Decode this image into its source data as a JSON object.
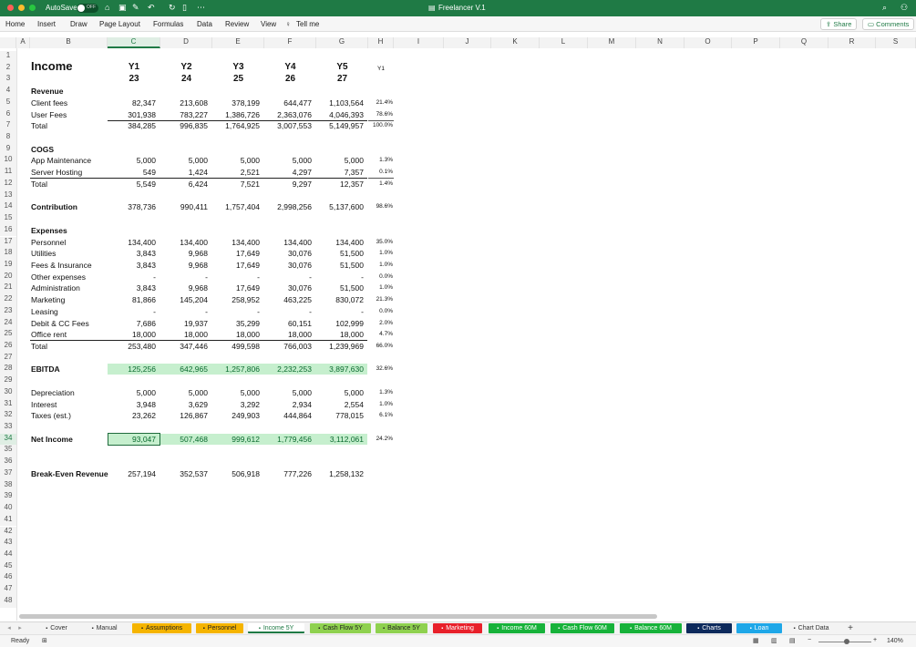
{
  "app": {
    "autosave_label": "AutoSave",
    "autosave_state": "OFF",
    "title": "Freelancer V.1",
    "menu": [
      "Home",
      "Insert",
      "Draw",
      "Page Layout",
      "Formulas",
      "Data",
      "Review",
      "View",
      "Tell me"
    ],
    "share_label": "Share",
    "comments_label": "Comments"
  },
  "columns": [
    "A",
    "B",
    "C",
    "D",
    "E",
    "F",
    "G",
    "H",
    "I",
    "J",
    "K",
    "L",
    "M",
    "N",
    "O",
    "P",
    "Q",
    "R",
    "S"
  ],
  "row_numbers": [
    "1",
    "2",
    "3",
    "4",
    "5",
    "6",
    "7",
    "8",
    "9",
    "10",
    "11",
    "12",
    "13",
    "14",
    "15",
    "16",
    "17",
    "18",
    "19",
    "20",
    "21",
    "22",
    "23",
    "24",
    "25",
    "26",
    "27",
    "28",
    "29",
    "30",
    "31",
    "32",
    "33",
    "34",
    "35",
    "36",
    "37",
    "38",
    "39",
    "40",
    "41",
    "42",
    "43",
    "44",
    "45",
    "46",
    "47",
    "48"
  ],
  "sheet": {
    "title": "Income",
    "year_labels": [
      "Y1",
      "Y2",
      "Y3",
      "Y4",
      "Y5"
    ],
    "years": [
      "23",
      "24",
      "25",
      "26",
      "27"
    ],
    "pct_header": "Y1",
    "rows": [
      {
        "row": 4,
        "label": "Revenue",
        "bold": true
      },
      {
        "row": 5,
        "label": "Client fees",
        "values": [
          "82,347",
          "213,608",
          "378,199",
          "644,477",
          "1,103,564"
        ],
        "pct": "21.4%"
      },
      {
        "row": 6,
        "label": "User Fees",
        "values": [
          "301,938",
          "783,227",
          "1,386,726",
          "2,363,076",
          "4,046,393"
        ],
        "pct": "78.6%"
      },
      {
        "row": 7,
        "label": "Total",
        "values": [
          "384,285",
          "996,835",
          "1,764,925",
          "3,007,553",
          "5,149,957"
        ],
        "pct": "100.0%"
      },
      {
        "row": 9,
        "label": "COGS",
        "bold": true
      },
      {
        "row": 10,
        "label": "App Maintenance",
        "values": [
          "5,000",
          "5,000",
          "5,000",
          "5,000",
          "5,000"
        ],
        "pct": "1.3%"
      },
      {
        "row": 11,
        "label": "Server Hosting",
        "values": [
          "549",
          "1,424",
          "2,521",
          "4,297",
          "7,357"
        ],
        "pct": "0.1%"
      },
      {
        "row": 12,
        "label": "Total",
        "values": [
          "5,549",
          "6,424",
          "7,521",
          "9,297",
          "12,357"
        ],
        "pct": "1.4%"
      },
      {
        "row": 14,
        "label": "Contribution",
        "bold": true,
        "values": [
          "378,736",
          "990,411",
          "1,757,404",
          "2,998,256",
          "5,137,600"
        ],
        "pct": "98.6%"
      },
      {
        "row": 16,
        "label": "Expenses",
        "bold": true
      },
      {
        "row": 17,
        "label": "Personnel",
        "values": [
          "134,400",
          "134,400",
          "134,400",
          "134,400",
          "134,400"
        ],
        "pct": "35.0%"
      },
      {
        "row": 18,
        "label": "Utilities",
        "values": [
          "3,843",
          "9,968",
          "17,649",
          "30,076",
          "51,500"
        ],
        "pct": "1.0%"
      },
      {
        "row": 19,
        "label": "Fees & Insurance",
        "values": [
          "3,843",
          "9,968",
          "17,649",
          "30,076",
          "51,500"
        ],
        "pct": "1.0%"
      },
      {
        "row": 20,
        "label": "Other expenses",
        "values": [
          "-",
          "-",
          "-",
          "-",
          "-"
        ],
        "pct": "0.0%"
      },
      {
        "row": 21,
        "label": "Administration",
        "values": [
          "3,843",
          "9,968",
          "17,649",
          "30,076",
          "51,500"
        ],
        "pct": "1.0%"
      },
      {
        "row": 22,
        "label": "Marketing",
        "values": [
          "81,866",
          "145,204",
          "258,952",
          "463,225",
          "830,072"
        ],
        "pct": "21.3%"
      },
      {
        "row": 23,
        "label": "Leasing",
        "values": [
          "-",
          "-",
          "-",
          "-",
          "-"
        ],
        "pct": "0.0%"
      },
      {
        "row": 24,
        "label": "Debit & CC Fees",
        "values": [
          "7,686",
          "19,937",
          "35,299",
          "60,151",
          "102,999"
        ],
        "pct": "2.0%"
      },
      {
        "row": 25,
        "label": "Office rent",
        "values": [
          "18,000",
          "18,000",
          "18,000",
          "18,000",
          "18,000"
        ],
        "pct": "4.7%"
      },
      {
        "row": 26,
        "label": "Total",
        "values": [
          "253,480",
          "347,446",
          "499,598",
          "766,003",
          "1,239,969"
        ],
        "pct": "66.0%"
      },
      {
        "row": 28,
        "label": "EBITDA",
        "bold": true,
        "green": true,
        "values": [
          "125,256",
          "642,965",
          "1,257,806",
          "2,232,253",
          "3,897,630"
        ],
        "pct": "32.6%"
      },
      {
        "row": 30,
        "label": "Depreciation",
        "values": [
          "5,000",
          "5,000",
          "5,000",
          "5,000",
          "5,000"
        ],
        "pct": "1.3%"
      },
      {
        "row": 31,
        "label": "Interest",
        "values": [
          "3,948",
          "3,629",
          "3,292",
          "2,934",
          "2,554"
        ],
        "pct": "1.0%"
      },
      {
        "row": 32,
        "label": "Taxes (est.)",
        "values": [
          "23,262",
          "126,867",
          "249,903",
          "444,864",
          "778,015"
        ],
        "pct": "6.1%"
      },
      {
        "row": 34,
        "label": "Net Income",
        "bold": true,
        "green": true,
        "values": [
          "93,047",
          "507,468",
          "999,612",
          "1,779,456",
          "3,112,061"
        ],
        "pct": "24.2%"
      },
      {
        "row": 37,
        "label": "Break-Even Revenue",
        "bold": true,
        "values": [
          "257,194",
          "352,537",
          "506,918",
          "777,226",
          "1,258,132"
        ]
      }
    ]
  },
  "tabs": [
    {
      "label": "Cover",
      "bg": "#f3f3f3",
      "color": "#333",
      "lock": true
    },
    {
      "label": "Manual",
      "bg": "#f3f3f3",
      "color": "#333",
      "lock": true
    },
    {
      "label": "Assumptions",
      "bg": "#f5b400",
      "color": "#222",
      "lock": true
    },
    {
      "label": "Personnel",
      "bg": "#f5b400",
      "color": "#222",
      "lock": true
    },
    {
      "label": "Income 5Y",
      "bg": "#ffffff",
      "color": "#1f7a45",
      "lock": true,
      "active": true
    },
    {
      "label": "Cash Flow 5Y",
      "bg": "#8fd14f",
      "color": "#222",
      "lock": true
    },
    {
      "label": "Balance 5Y",
      "bg": "#8fd14f",
      "color": "#222",
      "lock": true
    },
    {
      "label": "Marketing",
      "bg": "#e8202a",
      "color": "#fff",
      "lock": true
    },
    {
      "label": "Income 60M",
      "bg": "#17b23a",
      "color": "#fff",
      "lock": true
    },
    {
      "label": "Cash Flow 60M",
      "bg": "#17b23a",
      "color": "#fff",
      "lock": true
    },
    {
      "label": "Balance 60M",
      "bg": "#17b23a",
      "color": "#fff",
      "lock": true
    },
    {
      "label": "Charts",
      "bg": "#0d2a5c",
      "color": "#fff",
      "lock": true
    },
    {
      "label": "Loan",
      "bg": "#1ea7e8",
      "color": "#fff",
      "lock": true
    },
    {
      "label": "Chart Data",
      "bg": "#f3f3f3",
      "color": "#333",
      "lock": true
    }
  ],
  "status": {
    "ready": "Ready",
    "zoom": "140%"
  },
  "colors": {
    "excel_green": "#1f7a45",
    "highlight_green": "#c6efce"
  }
}
